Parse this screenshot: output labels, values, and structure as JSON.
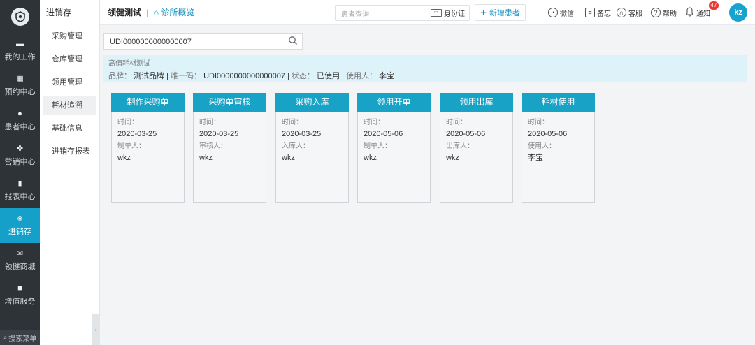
{
  "sidebar": {
    "search_label": "搜索菜单",
    "items": [
      {
        "label": "我的工作",
        "icon": "monitor-icon"
      },
      {
        "label": "预约中心",
        "icon": "calendar-icon"
      },
      {
        "label": "患者中心",
        "icon": "user-icon"
      },
      {
        "label": "营销中心",
        "icon": "fan-icon"
      },
      {
        "label": "报表中心",
        "icon": "bar-chart-icon"
      },
      {
        "label": "进销存",
        "icon": "layers-icon",
        "active": true
      },
      {
        "label": "领健商城",
        "icon": "mail-icon"
      },
      {
        "label": "增值服务",
        "icon": "grid-icon"
      }
    ]
  },
  "submenu": {
    "title": "进销存",
    "items": [
      {
        "label": "采购管理"
      },
      {
        "label": "仓库管理"
      },
      {
        "label": "领用管理"
      },
      {
        "label": "耗材追溯",
        "active": true
      },
      {
        "label": "基础信息"
      },
      {
        "label": "进销存报表"
      }
    ]
  },
  "topbar": {
    "brand": "领健测试",
    "separator": "|",
    "clinic_link": "诊所概览",
    "patient_search_placeholder": "患者查询",
    "id_card_label": "身份证",
    "new_patient_label": "新增患者",
    "wechat_label": "微信",
    "memo_label": "备忘",
    "service_label": "客服",
    "help_label": "帮助",
    "notify_label": "通知",
    "notify_count": "47",
    "avatar_initials": "kz"
  },
  "search": {
    "value": "UDI0000000000000007"
  },
  "item_info": {
    "name": "高值耗材测试",
    "brand_label": "品牌：",
    "brand_value": "测试品牌",
    "code_label": "唯一码：",
    "code_value": "UDI0000000000000007",
    "status_label": "状态：",
    "status_value": "已使用",
    "user_label": "使用人：",
    "user_value": "李宝",
    "sep": "|"
  },
  "timeline": [
    {
      "title": "制作采购单",
      "time_label": "时间：",
      "time": "2020-03-25",
      "person_label": "制单人：",
      "person": "wkz"
    },
    {
      "title": "采购单审核",
      "time_label": "时间：",
      "time": "2020-03-25",
      "person_label": "审核人：",
      "person": "wkz"
    },
    {
      "title": "采购入库",
      "time_label": "时间：",
      "time": "2020-03-25",
      "person_label": "入库人：",
      "person": "wkz"
    },
    {
      "title": "领用开单",
      "time_label": "时间：",
      "time": "2020-05-06",
      "person_label": "制单人：",
      "person": "wkz"
    },
    {
      "title": "领用出库",
      "time_label": "时间：",
      "time": "2020-05-06",
      "person_label": "出库人：",
      "person": "wkz"
    },
    {
      "title": "耗材使用",
      "time_label": "时间：",
      "time": "2020-05-06",
      "person_label": "使用人：",
      "person": "李宝"
    }
  ],
  "colors": {
    "accent": "#17a2c6",
    "nav_bg": "#2e3338",
    "info_bg": "#def2fa",
    "badge": "#e63b2e"
  }
}
